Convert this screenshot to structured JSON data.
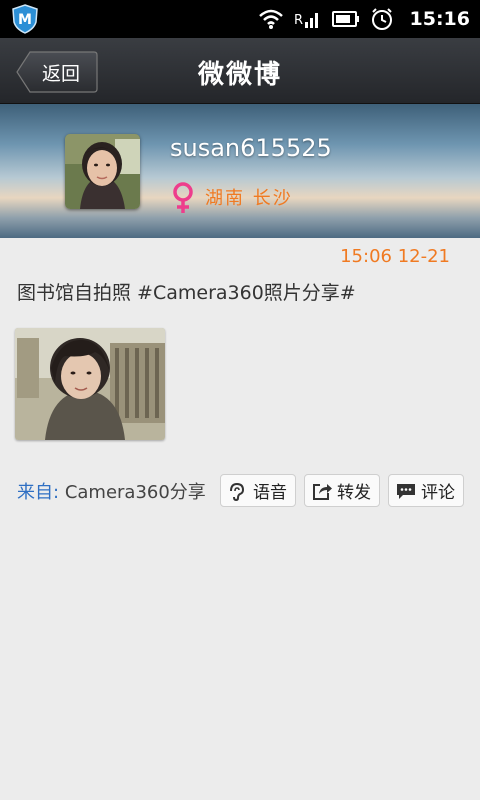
{
  "status_bar": {
    "time": "15:16",
    "icons": [
      "app-m-icon",
      "wifi-icon",
      "signal-icon",
      "battery-icon",
      "alarm-icon"
    ]
  },
  "header": {
    "back_label": "返回",
    "title": "微微博"
  },
  "profile": {
    "username": "susan615525",
    "location": "湖南 长沙",
    "gender_icon": "female-icon"
  },
  "post": {
    "timestamp": "15:06 12-21",
    "text": "图书馆自拍照 #Camera360照片分享#",
    "source_label": "来自:",
    "source_name": "Camera360分享"
  },
  "actions": [
    {
      "label": "语音",
      "icon": "voice-icon"
    },
    {
      "label": "转发",
      "icon": "repost-icon"
    },
    {
      "label": "评论",
      "icon": "comment-icon"
    }
  ],
  "colors": {
    "accent_orange": "#f07a22",
    "link_blue": "#2f6fc3",
    "gender_pink": "#ee3d8c"
  }
}
